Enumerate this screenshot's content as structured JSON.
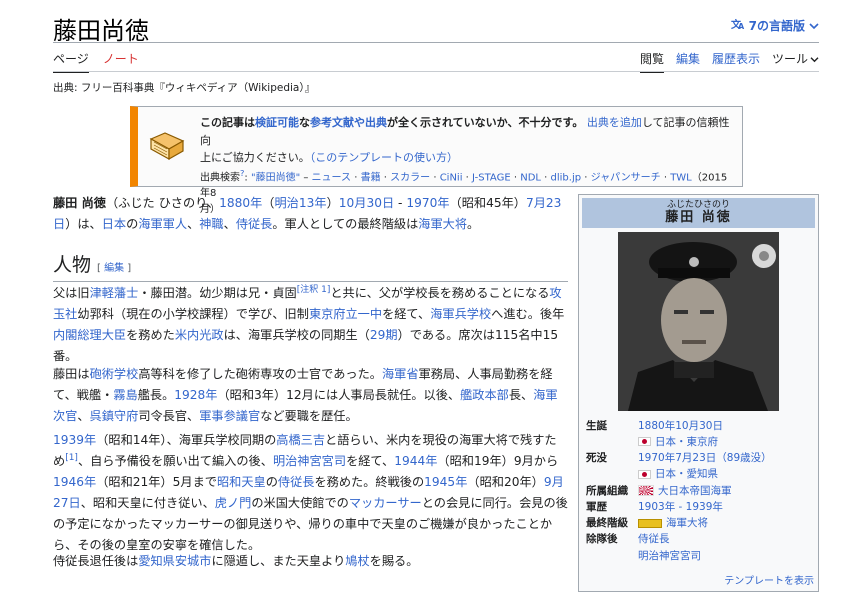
{
  "page": {
    "title": "藤田尚徳",
    "lang_button": "7の言語版"
  },
  "tabs": {
    "left": [
      "ページ",
      "ノート"
    ],
    "right": [
      "閲覧",
      "編集",
      "履歴表示",
      "ツール"
    ]
  },
  "source_line": "出典: フリー百科事典『ウィキペディア（Wikipedia）』",
  "ambox": {
    "line1_bold1": "この記事は",
    "line1_link1": "検証可能",
    "line1_bold2": "な",
    "line1_link2": "参考文献や出典",
    "line1_bold3": "が全く示されていないか、不十分です。",
    "line1_link3": "出典を追加",
    "line1_tail": "して記事の信頼性向",
    "line2": "上にご協力ください。",
    "line2_link": "（このテンプレートの使い方）",
    "search_label": "出典検索",
    "search_sup": "?",
    "search_items": [
      "\"藤田尚徳\"",
      "ニュース",
      "書籍",
      "スカラー",
      "CiNii",
      "J-STAGE",
      "NDL",
      "dlib.jp",
      "ジャパンサーチ",
      "TWL"
    ],
    "search_date": "（2015年8",
    "search_date2": "月）"
  },
  "intro": {
    "name": "藤田 尚徳",
    "reading": "（ふじた ひさのり、",
    "birth_year": "1880年",
    "birth_era": "明治13年",
    "birth_day": "10月30日",
    "death_year": "1970年",
    "death_era_pre": "（昭和45年）",
    "death_day": "7月23",
    "death_day2": "日",
    "line2_a": "）は、",
    "line2_b": "日本",
    "line2_c": "の",
    "line2_d": "海軍軍人",
    "line2_e": "、",
    "line2_f": "神職",
    "line2_g": "、",
    "line2_h": "侍従長",
    "line2_i": "。軍人としての最終階級は",
    "line2_j": "海軍大将",
    "line2_k": "。"
  },
  "section": {
    "heading": "人物",
    "edit_label": "編集"
  },
  "paras": {
    "p1": [
      [
        "父は旧",
        ""
      ],
      [
        "津軽藩士",
        "a"
      ],
      [
        "・藤田潜。幼少期は兄・貞固",
        ""
      ],
      [
        "[注釈 1]",
        "sup"
      ],
      [
        "と共に、父が学校長を務めることになる",
        ""
      ],
      [
        "攻玉社",
        "a"
      ],
      [
        "幼郛科（現在の小学校課程）で学び、旧制",
        ""
      ],
      [
        "東京府立一中",
        "a"
      ],
      [
        "を経て、",
        ""
      ],
      [
        "海軍兵学校",
        "a"
      ],
      [
        "へ進む。後年",
        ""
      ],
      [
        "内閣総理大臣",
        "a"
      ],
      [
        "を務めた",
        ""
      ],
      [
        "米内光政",
        "a"
      ],
      [
        "は、海軍兵学校の同期生（",
        ""
      ],
      [
        "29期",
        "a"
      ],
      [
        "）である。席次は115名中15番。",
        ""
      ]
    ],
    "p2": [
      [
        "藤田は",
        ""
      ],
      [
        "砲術学校",
        "a"
      ],
      [
        "高等科を修了した砲術専攻の士官であった。",
        ""
      ],
      [
        "海軍省",
        "a"
      ],
      [
        "軍務局、人事局勤務を経て、戦艦・",
        ""
      ],
      [
        "霧島",
        "a"
      ],
      [
        "艦長。",
        ""
      ],
      [
        "1928年",
        "a"
      ],
      [
        "（昭和3年）12月には人事局長就任。以後、",
        ""
      ],
      [
        "艦政本部",
        "a"
      ],
      [
        "長、",
        ""
      ],
      [
        "海軍次官",
        "a"
      ],
      [
        "、",
        ""
      ],
      [
        "呉鎮守府",
        "a"
      ],
      [
        "司令長官、",
        ""
      ],
      [
        "軍事参議官",
        "a"
      ],
      [
        "など要職を歴任。",
        ""
      ]
    ],
    "p3": [
      [
        "1939年",
        "a"
      ],
      [
        "（昭和14年）、海軍兵学校同期の",
        ""
      ],
      [
        "高橋三吉",
        "a"
      ],
      [
        "と語らい、米内を現役の海軍大将で残すため",
        ""
      ],
      [
        "[1]",
        "sup"
      ],
      [
        "、自ら予備役を願い出て編入の後、",
        ""
      ],
      [
        "明治神宮宮司",
        "a"
      ],
      [
        "を経て、",
        ""
      ],
      [
        "1944年",
        "a"
      ],
      [
        "（昭和19年）9月から",
        ""
      ],
      [
        "1946年",
        "a"
      ],
      [
        "（昭和21年）5月まで",
        ""
      ],
      [
        "昭和天皇",
        "a"
      ],
      [
        "の",
        ""
      ],
      [
        "侍従長",
        "a"
      ],
      [
        "を務めた。終戦後の",
        ""
      ],
      [
        "1945年",
        "a"
      ],
      [
        "（昭和20年）",
        ""
      ],
      [
        "9月27日",
        "a"
      ],
      [
        "、昭和天皇に付き従い、",
        ""
      ],
      [
        "虎ノ門",
        "a"
      ],
      [
        "の米国大使館での",
        ""
      ],
      [
        "マッカーサー",
        "a"
      ],
      [
        "との会見に同行。会見の後の予定になかったマッカーサーの御見送りや、帰りの車中で天皇のご機嫌が良かったことから、その後の皇室の安寧を確信した。",
        ""
      ]
    ],
    "p4": [
      [
        "侍従長退任後は",
        ""
      ],
      [
        "愛知県",
        "a"
      ],
      [
        "安城市",
        "a"
      ],
      [
        "に隠遁し、また天皇より",
        ""
      ],
      [
        "鳩杖",
        "a"
      ],
      [
        "を賜る。",
        ""
      ]
    ]
  },
  "infobox": {
    "ruby": "ふじたひさのり",
    "name": "藤田 尚徳",
    "rows": [
      {
        "k": "生誕",
        "v1": "1880年10月30日",
        "v2": "日本・東京府",
        "flag": "japan"
      },
      {
        "k": "死没",
        "v1": "1970年7月23日（89歳没）",
        "v2": "日本・愛知県",
        "flag": "japan"
      },
      {
        "k": "所属組織",
        "v1": "大日本帝国海軍",
        "flag": "rising"
      },
      {
        "k": "軍歴",
        "v1": "1903年 - 1939年"
      },
      {
        "k": "最終階級",
        "v1": "海軍大将",
        "flag": "rank"
      },
      {
        "k": "除隊後",
        "v1": "侍従長",
        "v2": "明治神宮宮司"
      }
    ],
    "template_link": "テンプレートを表示"
  },
  "icons": [
    "translate-icon",
    "chevron-down-icon",
    "book-icon",
    "flag-icon"
  ],
  "colors": {
    "link": "#3366cc",
    "ambox_border": "#f28500",
    "infobox_head": "#b0c4de"
  }
}
